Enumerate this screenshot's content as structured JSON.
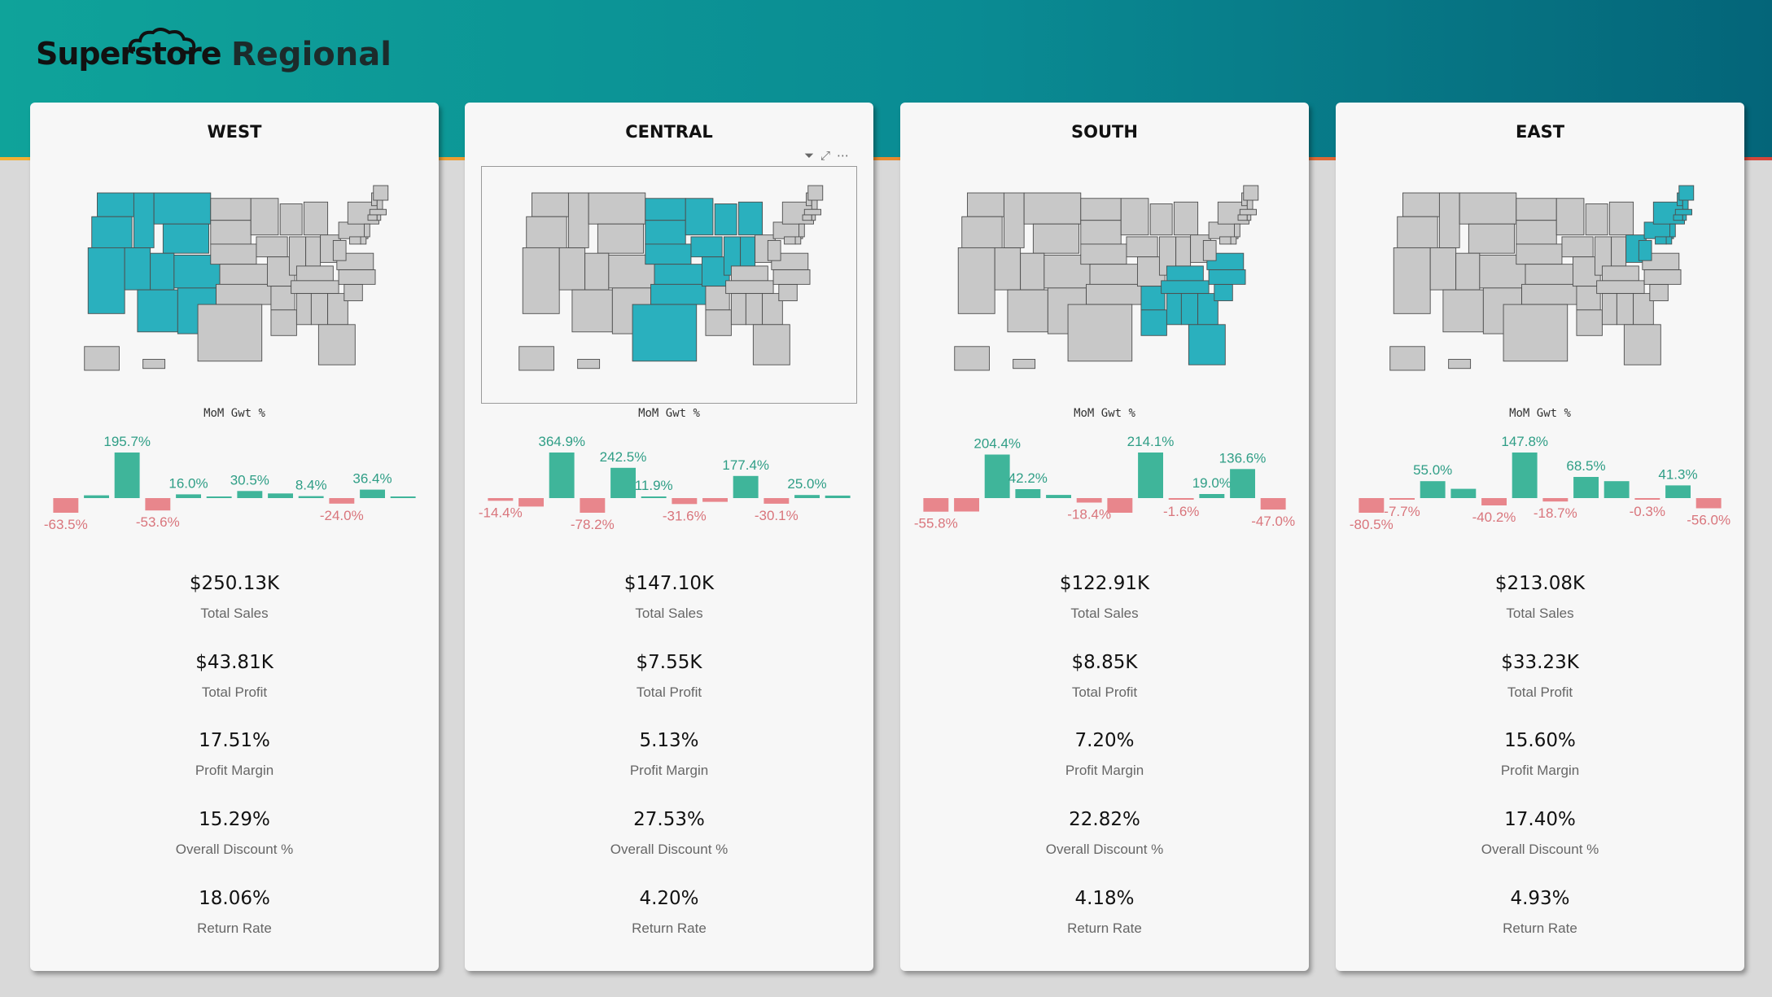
{
  "app": {
    "logo_text": "Superstore",
    "page_title": "Regional",
    "icons": {
      "filter": "filter-icon",
      "focus": "focus-mode-icon",
      "more": "more-options-icon"
    }
  },
  "colors": {
    "positive": "#3fb59a",
    "negative": "#e8868c",
    "highlight_state": "#2ab0be",
    "other_state": "#c8c8c8",
    "header_start": "#0fa39a",
    "header_end": "#046579"
  },
  "labels": {
    "chart_title": "MoM Gwt %",
    "total_sales": "Total Sales",
    "total_profit": "Total Profit",
    "profit_margin": "Profit Margin",
    "overall_discount": "Overall Discount %",
    "return_rate": "Return Rate"
  },
  "regions": [
    {
      "name": "WEST",
      "kpis": {
        "total_sales": "$250.13K",
        "total_profit": "$43.81K",
        "profit_margin": "17.51%",
        "overall_discount": "15.29%",
        "return_rate": "18.06%"
      }
    },
    {
      "name": "CENTRAL",
      "kpis": {
        "total_sales": "$147.10K",
        "total_profit": "$7.55K",
        "profit_margin": "5.13%",
        "overall_discount": "27.53%",
        "return_rate": "4.20%"
      }
    },
    {
      "name": "SOUTH",
      "kpis": {
        "total_sales": "$122.91K",
        "total_profit": "$8.85K",
        "profit_margin": "7.20%",
        "overall_discount": "22.82%",
        "return_rate": "4.18%"
      }
    },
    {
      "name": "EAST",
      "kpis": {
        "total_sales": "$213.08K",
        "total_profit": "$33.23K",
        "profit_margin": "15.60%",
        "overall_discount": "17.40%",
        "return_rate": "4.93%"
      }
    }
  ],
  "chart_data": [
    {
      "type": "bar",
      "title": "MoM Gwt %",
      "region": "WEST",
      "values": [
        -63.5,
        12,
        195.7,
        -53.6,
        16.0,
        3,
        30.5,
        20,
        8.4,
        -24.0,
        36.4,
        2
      ],
      "data_labels": {
        "0": "-63.5%",
        "2": "195.7%",
        "3": "-53.6%",
        "4": "16.0%",
        "6": "30.5%",
        "8": "8.4%",
        "9": "-24.0%",
        "10": "36.4%"
      }
    },
    {
      "type": "bar",
      "title": "MoM Gwt %",
      "region": "CENTRAL",
      "values": [
        -14.4,
        -45,
        364.9,
        -78.2,
        242.5,
        11.9,
        -31.6,
        -20,
        177.4,
        -30.1,
        25.0,
        20
      ],
      "data_labels": {
        "0": "-14.4%",
        "2": "364.9%",
        "3": "-78.2%",
        "4": "242.5%",
        "5": "11.9%",
        "6": "-31.6%",
        "8": "177.4%",
        "9": "-30.1%",
        "10": "25.0%"
      }
    },
    {
      "type": "bar",
      "title": "MoM Gwt %",
      "region": "SOUTH",
      "values": [
        -55.8,
        -55,
        204.4,
        42.2,
        15,
        -18.4,
        -60,
        214.1,
        -1.6,
        19.0,
        136.6,
        -47.0
      ],
      "data_labels": {
        "0": "-55.8%",
        "2": "204.4%",
        "3": "42.2%",
        "5": "-18.4%",
        "7": "214.1%",
        "8": "-1.6%",
        "9": "19.0%",
        "10": "136.6%",
        "11": "-47.0%"
      }
    },
    {
      "type": "bar",
      "title": "MoM Gwt %",
      "region": "EAST",
      "values": [
        -80.5,
        -7.7,
        55.0,
        30,
        -40.2,
        147.8,
        -18.7,
        68.5,
        55,
        -0.3,
        41.3,
        -56.0
      ],
      "data_labels": {
        "0": "-80.5%",
        "1": "-7.7%",
        "2": "55.0%",
        "4": "-40.2%",
        "5": "147.8%",
        "6": "-18.7%",
        "7": "68.5%",
        "9": "-0.3%",
        "10": "41.3%",
        "11": "-56.0%"
      }
    }
  ]
}
